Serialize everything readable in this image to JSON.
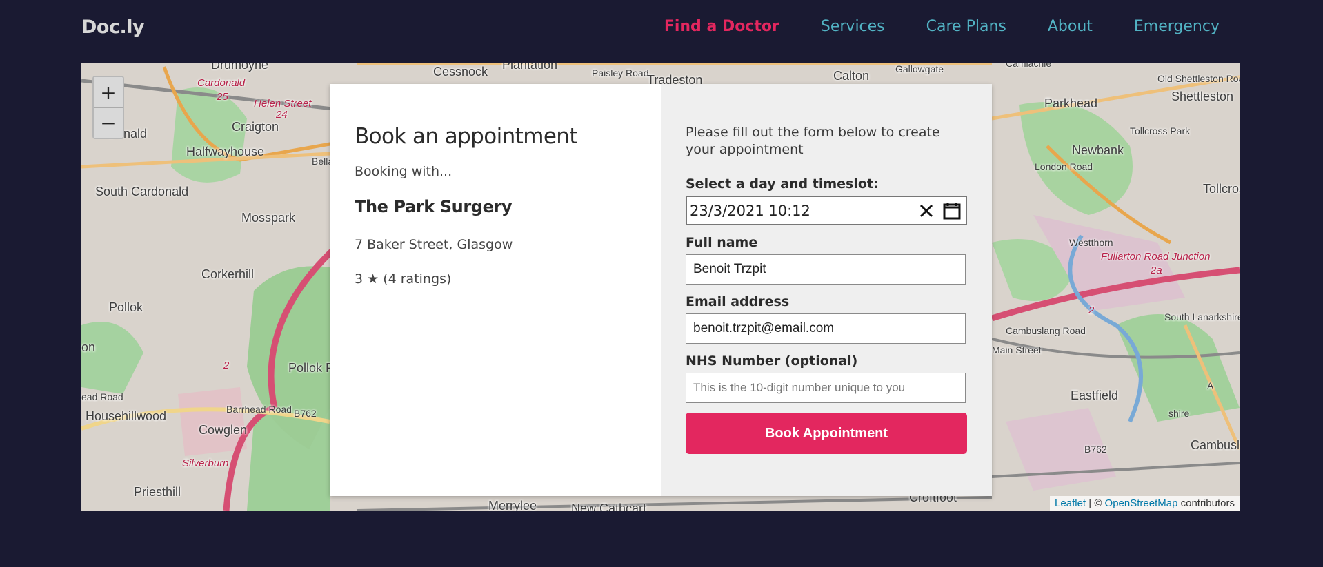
{
  "header": {
    "brand": "Doc.ly",
    "nav": [
      {
        "label": "Find a Doctor",
        "active": true
      },
      {
        "label": "Services"
      },
      {
        "label": "Care Plans"
      },
      {
        "label": "About"
      },
      {
        "label": "Emergency"
      }
    ]
  },
  "map": {
    "zoom_in": "+",
    "zoom_out": "−",
    "labels": {
      "drumoyne": "Drumoyne",
      "plantation": "Plantation",
      "cessnock": "Cessnock",
      "paisley_road": "Paisley Road",
      "tradeston": "Tradeston",
      "calton": "Calton",
      "gallowgate": "Gallowgate",
      "camlachie": "Camlachie",
      "old_shettleston_road": "Old Shettleston Road",
      "cardonald": "Cardonald",
      "helen_street": "Helen Street",
      "craigton": "Craigton",
      "halfwayhouse": "Halfwayhouse",
      "bellahouston": "Bellahouston Park",
      "donald": "Donald",
      "south_cardonald": "South Cardonald",
      "mosspark": "Mosspark",
      "corkerhill": "Corkerhill",
      "pollok": "Pollok",
      "pollok_park": "Pollok Park",
      "househillwood": "Househillwood",
      "barrhead_road": "Barrhead Road",
      "b762": "B762",
      "cowglen": "Cowglen",
      "silverburn": "Silverburn",
      "priesthill": "Priesthill",
      "merrylee": "Merrylee",
      "new_cathcart": "New Cathcart",
      "croftfoot": "Croftfoot",
      "parkhead": "Parkhead",
      "shettleston": "Shettleston",
      "tollcross_park": "Tollcross Park",
      "newbank": "Newbank",
      "london_road": "London Road",
      "tollcross": "Tollcross",
      "westthorn": "Westthorn",
      "fullarton_road_junction": "Fullarton Road Junction",
      "main_street": "Main Street",
      "cambuslang_road": "Cambuslang Road",
      "eastfield": "Eastfield",
      "b762_east": "B762",
      "cambuslang": "Cambuslang",
      "south_lanarkshire": "South Lanarkshire",
      "route_2": "2",
      "route_2a": "2a",
      "shire": "shire",
      "on": "on",
      "ead_road": "ead Road",
      "route_2b": "2",
      "route_25": "25",
      "route_24": "24",
      "a": "A"
    },
    "attribution": {
      "leaflet": "Leaflet",
      "sep": " | © ",
      "osm": "OpenStreetMap",
      "suffix": " contributors"
    }
  },
  "booking": {
    "title": "Book an appointment",
    "booking_with": "Booking with...",
    "surgery_name": "The Park Surgery",
    "address": "7 Baker Street, Glasgow",
    "rating": "3 ★ (4 ratings)"
  },
  "form": {
    "intro": "Please fill out the form below to create your appointment",
    "datetime_label": "Select a day and timeslot:",
    "datetime_value": "23/3/2021  10:12",
    "fullname_label": "Full name",
    "fullname_value": "Benoit Trzpit",
    "email_label": "Email address",
    "email_value": "benoit.trzpit@email.com",
    "nhs_label": "NHS Number (optional)",
    "nhs_placeholder": "This is the 10-digit number unique to you",
    "submit": "Book Appointment"
  }
}
